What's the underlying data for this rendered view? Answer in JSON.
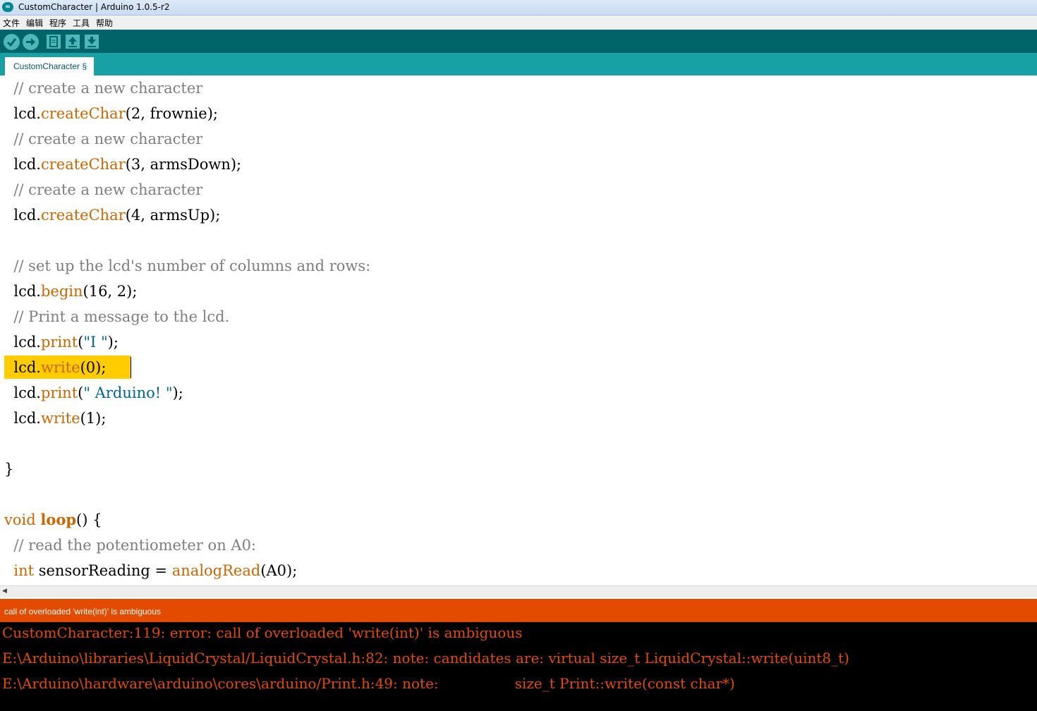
{
  "window": {
    "title": "CustomCharacter | Arduino 1.0.5-r2",
    "logo_text": "∞"
  },
  "menu": [
    "文件",
    "编辑",
    "程序",
    "工具",
    "帮助"
  ],
  "toolbar": {
    "buttons": [
      "verify",
      "upload",
      "new",
      "open",
      "save"
    ]
  },
  "tabs": [
    {
      "label": "CustomCharacter §",
      "active": true
    }
  ],
  "editor": {
    "code": [
      {
        "indent": "  ",
        "tokens": [
          [
            "com",
            "// create a new character"
          ]
        ]
      },
      {
        "indent": "  ",
        "tokens": [
          [
            "plain",
            "lcd."
          ],
          [
            "fn",
            "createChar"
          ],
          [
            "plain",
            "(2, frownie);"
          ]
        ]
      },
      {
        "indent": "  ",
        "tokens": [
          [
            "com",
            "// create a new character"
          ]
        ]
      },
      {
        "indent": "  ",
        "tokens": [
          [
            "plain",
            "lcd."
          ],
          [
            "fn",
            "createChar"
          ],
          [
            "plain",
            "(3, armsDown);"
          ]
        ]
      },
      {
        "indent": "  ",
        "tokens": [
          [
            "com",
            "// create a new character"
          ]
        ]
      },
      {
        "indent": "  ",
        "tokens": [
          [
            "plain",
            "lcd."
          ],
          [
            "fn",
            "createChar"
          ],
          [
            "plain",
            "(4, armsUp);"
          ]
        ]
      },
      {
        "indent": "",
        "tokens": []
      },
      {
        "indent": "  ",
        "tokens": [
          [
            "com",
            "// set up the lcd's number of columns and rows:"
          ]
        ]
      },
      {
        "indent": "  ",
        "tokens": [
          [
            "plain",
            "lcd."
          ],
          [
            "fn",
            "begin"
          ],
          [
            "plain",
            "(16, 2);"
          ]
        ]
      },
      {
        "indent": "  ",
        "tokens": [
          [
            "com",
            "// Print a message to the lcd."
          ]
        ]
      },
      {
        "indent": "  ",
        "tokens": [
          [
            "plain",
            "lcd."
          ],
          [
            "fn",
            "print"
          ],
          [
            "plain",
            "("
          ],
          [
            "str",
            "\"I \""
          ],
          [
            "plain",
            ");"
          ]
        ]
      },
      {
        "indent": "  ",
        "tokens": [
          [
            "plain",
            "lcd."
          ],
          [
            "fn",
            "write"
          ],
          [
            "plain",
            "(0);"
          ]
        ],
        "highlighted": true
      },
      {
        "indent": "  ",
        "tokens": [
          [
            "plain",
            "lcd."
          ],
          [
            "fn",
            "print"
          ],
          [
            "plain",
            "("
          ],
          [
            "str",
            "\" Arduino! \""
          ],
          [
            "plain",
            ");"
          ]
        ]
      },
      {
        "indent": "  ",
        "tokens": [
          [
            "plain",
            "lcd."
          ],
          [
            "fn",
            "write"
          ],
          [
            "plain",
            "(1);"
          ]
        ]
      },
      {
        "indent": "",
        "tokens": []
      },
      {
        "indent": "",
        "tokens": [
          [
            "plain",
            "}"
          ]
        ]
      },
      {
        "indent": "",
        "tokens": []
      },
      {
        "indent": "",
        "tokens": [
          [
            "kw",
            "void"
          ],
          [
            "plain",
            " "
          ],
          [
            "kwb",
            "loop"
          ],
          [
            "plain",
            "() {"
          ]
        ]
      },
      {
        "indent": "  ",
        "tokens": [
          [
            "com",
            "// read the potentiometer on A0:"
          ]
        ]
      },
      {
        "indent": "  ",
        "tokens": [
          [
            "kw",
            "int"
          ],
          [
            "plain",
            " sensorReading = "
          ],
          [
            "fn",
            "analogRead"
          ],
          [
            "plain",
            "(A0);"
          ]
        ]
      }
    ]
  },
  "status": {
    "message": "call of overloaded 'write(int)' is ambiguous"
  },
  "console": {
    "lines": [
      "CustomCharacter:119: error: call of overloaded 'write(int)' is ambiguous",
      "E:\\Arduino\\libraries\\LiquidCrystal/LiquidCrystal.h:82: note: candidates are: virtual size_t LiquidCrystal::write(uint8_t)",
      "E:\\Arduino\\hardware\\arduino\\cores\\arduino/Print.h:49: note:                 size_t Print::write(const char*)"
    ]
  },
  "colors": {
    "toolbar_bg": "#006468",
    "tabbar_bg": "#17a1a5",
    "status_bg": "#e34c00",
    "console_bg": "#000000",
    "console_text": "#e34c00",
    "highlight": "#ffcc00",
    "comment": "#7e7e7e",
    "keyword": "#cc6600",
    "string": "#006699"
  }
}
